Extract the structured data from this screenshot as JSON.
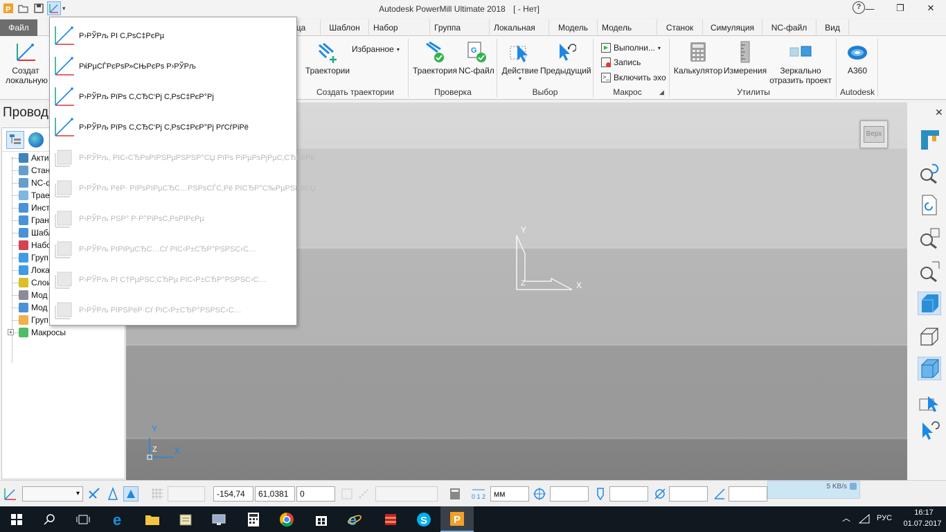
{
  "app": {
    "title": "Autodesk PowerMill Ultimate 2018",
    "project": "[ - Нет]",
    "help": "?"
  },
  "tabs": [
    {
      "label": "Файл"
    },
    {
      "label": "ица"
    },
    {
      "label": "Шаблон"
    },
    {
      "label": "Набор отверст"
    },
    {
      "label": "Группа элемен"
    },
    {
      "label": "Локальная СК"
    },
    {
      "label": "Модель"
    },
    {
      "label": "Модель матері"
    },
    {
      "label": "Станок"
    },
    {
      "label": "Симуляция"
    },
    {
      "label": "NC-файл"
    },
    {
      "label": "Вид"
    }
  ],
  "ribbon": {
    "create_local_line1": "Создат",
    "create_local_line2": "локальную",
    "trajectories": "Траектории",
    "favorites": "Избранное",
    "group_create": "Создать траектории",
    "check_traj": "Траектория",
    "check_nc": "NC-файл",
    "group_check": "Проверка",
    "action": "Действие",
    "previous": "Предыдущий",
    "group_select": "Выбор",
    "macro_run": "Выполни...",
    "macro_record": "Запись",
    "macro_echo": "Включить эхо",
    "group_macro": "Макрос",
    "calculator": "Калькулятор",
    "measure": "Измерения",
    "mirror_line1": "Зеркально",
    "mirror_line2": "отразить проект",
    "group_utils": "Утилиты",
    "a360": "A360",
    "group_autodesk": "Autodesk"
  },
  "explorer": {
    "title": "Провод",
    "items": [
      {
        "label": "Акти",
        "icon": "play-icon"
      },
      {
        "label": "Стан",
        "icon": "machine-icon"
      },
      {
        "label": "NC-ф",
        "icon": "nc-file-icon"
      },
      {
        "label": "Трае",
        "icon": "toolpath-icon"
      },
      {
        "label": "Инст",
        "icon": "tool-icon"
      },
      {
        "label": "Гран",
        "icon": "boundary-icon"
      },
      {
        "label": "Шабл",
        "icon": "pattern-icon"
      },
      {
        "label": "Набо",
        "icon": "holeset-icon"
      },
      {
        "label": "Груп",
        "icon": "group-icon"
      },
      {
        "label": "Лока",
        "icon": "workplane-icon"
      },
      {
        "label": "Слои",
        "icon": "layers-icon"
      },
      {
        "label": "Мод",
        "icon": "model-icon"
      },
      {
        "label": "Мод",
        "icon": "model-stock-icon"
      },
      {
        "label": "Груп",
        "icon": "folder-icon"
      },
      {
        "label": "Макросы",
        "icon": "macros-icon"
      }
    ]
  },
  "menu": {
    "items": [
      {
        "label": "Р›РЎРљ РІ С‚РѕС‡РєРµ",
        "enabled": true
      },
      {
        "label": "РќРµСЃРєРѕР»СЊРєРѕ Р›РЎРљ",
        "enabled": true
      },
      {
        "label": "Р›РЎРљ РїРѕ С‚СЂС‘Рј С‚РѕС‡РєР°Рј",
        "enabled": true
      },
      {
        "label": "Р›РЎРљ РїРѕ С‚СЂС‘Рј С‚РѕС‡РєР°Рј РґСѓРіРё",
        "enabled": true
      },
      {
        "label": "Р›РЎРљ, РІС‹СЂРѕРІРЅРµРЅРЅР°СЏ РїРѕ РіРµРѕРјРµС‚СЂРёРё",
        "enabled": false
      },
      {
        "label": "Р›РЎРљ РёР· РїРѕРІРµСЂС…РЅРѕСЃС‚Рё РІСЂР°С‰РµРЅРёСЏ",
        "enabled": false
      },
      {
        "label": "Р›РЎРљ РЅР° Р·Р°РіРѕС‚РѕРІРєРµ",
        "enabled": false
      },
      {
        "label": "Р›РЎРљ РІРІРµСЂС…Сѓ РІС‹Р±СЂР°РЅРЅС‹С…",
        "enabled": false
      },
      {
        "label": "Р›РЎРљ РІ С†РµРЅС‚СЂРµ РІС‹Р±СЂР°РЅРЅС‹С…",
        "enabled": false
      },
      {
        "label": "Р›РЎРљ РІРЅРёР·Сѓ РІС‹Р±СЂР°РЅРЅС‹С…",
        "enabled": false
      }
    ]
  },
  "viewport": {
    "view_cube_label": "Верх",
    "axis_x": "X",
    "axis_y": "Y",
    "axis_z": "Z"
  },
  "status": {
    "x": "-154,74",
    "y": "61,0381",
    "z": "0",
    "units": "мм",
    "net_speed": "5 KB/s"
  },
  "tray": {
    "lang": "РУС",
    "time": "16:17",
    "date": "01.07.2017"
  },
  "colors": {
    "accent": "#1e88e5",
    "file_tab": "#6d6d6d",
    "taskbar": "#101820"
  }
}
